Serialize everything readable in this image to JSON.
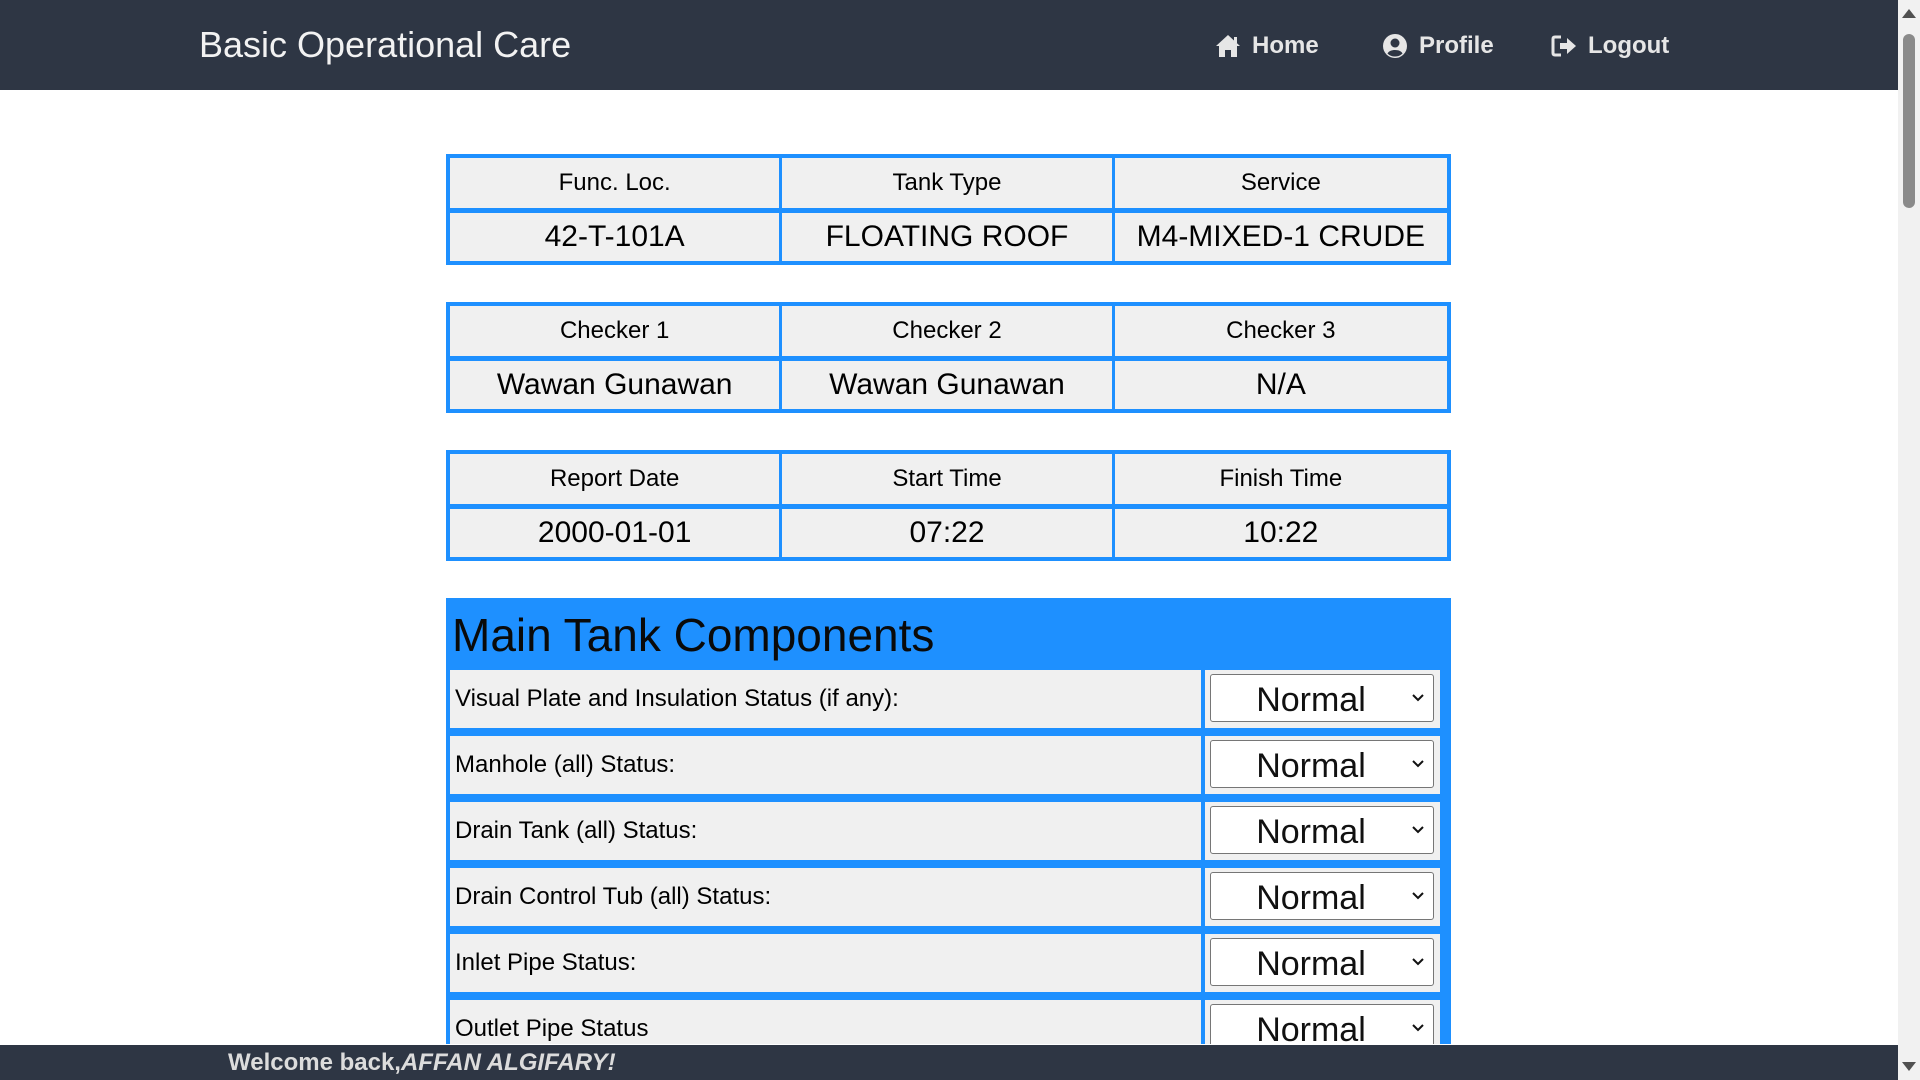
{
  "navbar": {
    "brand": "Basic Operational Care",
    "home_label": "Home",
    "profile_label": "Profile",
    "logout_label": "Logout",
    "home_icon": "home-icon",
    "profile_icon": "user-circle-icon",
    "logout_icon": "sign-out-icon"
  },
  "tank_info": {
    "headers": [
      "Func. Loc.",
      "Tank Type",
      "Service"
    ],
    "values": [
      "42-T-101A",
      "FLOATING ROOF",
      "M4-MIXED-1 CRUDE"
    ]
  },
  "checkers": {
    "headers": [
      "Checker 1",
      "Checker 2",
      "Checker 3"
    ],
    "values": [
      "Wawan Gunawan",
      "Wawan Gunawan",
      "N/A"
    ]
  },
  "timing": {
    "headers": [
      "Report Date",
      "Start Time",
      "Finish Time"
    ],
    "values": [
      "2000-01-01",
      "07:22",
      "10:22"
    ]
  },
  "components": {
    "title": "Main Tank Components",
    "rows": [
      {
        "label": "Visual Plate and Insulation Status (if any):",
        "value": "Normal"
      },
      {
        "label": "Manhole (all) Status:",
        "value": "Normal"
      },
      {
        "label": "Drain Tank (all) Status:",
        "value": "Normal"
      },
      {
        "label": "Drain Control Tub (all) Status:",
        "value": "Normal"
      },
      {
        "label": "Inlet Pipe Status:",
        "value": "Normal"
      },
      {
        "label": "Outlet Pipe Status",
        "value": "Normal"
      }
    ]
  },
  "footer": {
    "welcome_prefix": "Welcome back,",
    "user_name": "AFFAN ALGIFARY!"
  },
  "colors": {
    "navbar_bg": "#2e3644",
    "accent_blue": "#1e90ff",
    "cell_bg": "#f0f0f0"
  }
}
